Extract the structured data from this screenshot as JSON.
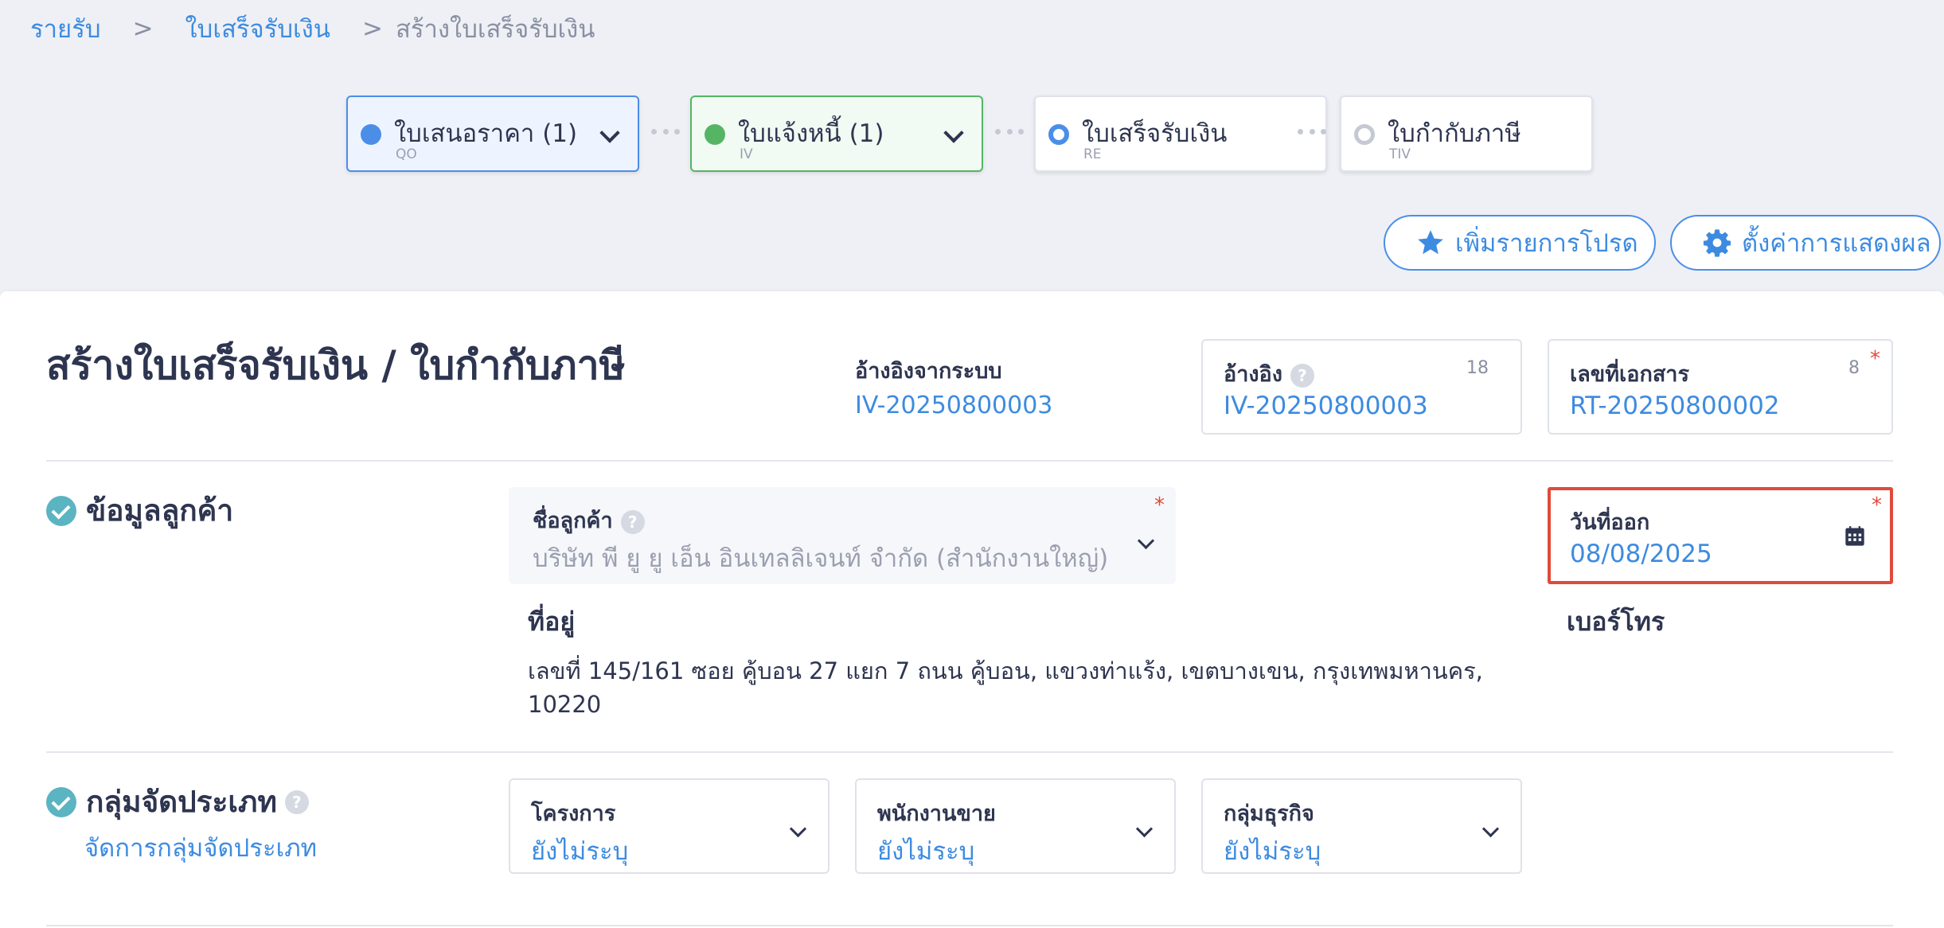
{
  "breadcrumb": {
    "items": [
      {
        "label": "รายรับ"
      },
      {
        "label": "ใบเสร็จรับเงิน"
      },
      {
        "label": "สร้างใบเสร็จรับเงิน"
      }
    ],
    "separator": ">"
  },
  "stepper": {
    "steps": [
      {
        "title": "ใบเสนอราคา (1)",
        "code": "QO",
        "color": "#4b8ee8"
      },
      {
        "title": "ใบแจ้งหนี้ (1)",
        "code": "IV",
        "color": "#56b565"
      },
      {
        "title": "ใบเสร็จรับเงิน",
        "code": "RE",
        "color": "#4b8ee8"
      },
      {
        "title": "ใบกำกับภาษี",
        "code": "TIV",
        "color": "#c5c9d3"
      }
    ]
  },
  "actions": {
    "favorite_label": "เพิ่มรายการโปรด",
    "settings_label": "ตั้งค่าการแสดงผล"
  },
  "document": {
    "title": "สร้างใบเสร็จรับเงิน / ใบกำกับภาษี",
    "system_ref_label": "อ้างอิงจากระบบ",
    "system_ref_value": "IV-20250800003",
    "reference_label": "อ้างอิง",
    "reference_value": "IV-20250800003",
    "reference_count": "18",
    "doc_number_label": "เลขที่เอกสาร",
    "doc_number_value": "RT-20250800002",
    "doc_number_count": "8",
    "required_mark": "*",
    "help_mark": "?"
  },
  "customer": {
    "section_title": "ข้อมูลลูกค้า",
    "name_label": "ชื่อลูกค้า",
    "name_value": "บริษัท พี ยู ยู เอ็น อินเทลลิเจนท์ จำกัด (สำนักงานใหญ่)",
    "issue_date_label": "วันที่ออก",
    "issue_date_value": "08/08/2025",
    "address_label": "ที่อยู่",
    "address_line1": "เลขที่ 145/161 ซอย คู้บอน 27 แยก 7 ถนน คู้บอน, แขวงท่าแร้ง, เขตบางเขน, กรุงเทพมหานคร,",
    "address_line2": "10220",
    "phone_label": "เบอร์โทร"
  },
  "category": {
    "section_title": "กลุ่มจัดประเภท",
    "manage_link": "จัดการกลุ่มจัดประเภท",
    "project_label": "โครงการ",
    "project_value": "ยังไม่ระบุ",
    "sales_label": "พนักงานขาย",
    "sales_value": "ยังไม่ระบุ",
    "business_label": "กลุ่มธุรกิจ",
    "business_value": "ยังไม่ระบุ"
  }
}
